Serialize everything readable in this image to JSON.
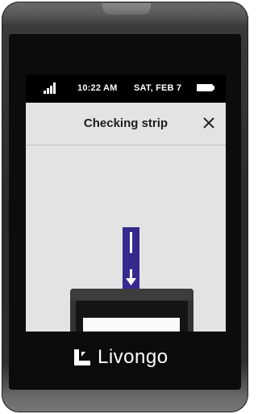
{
  "status_bar": {
    "time": "10:22 AM",
    "date": "SAT, FEB 7",
    "signal_icon": "signal-bars-icon",
    "battery_icon": "battery-full-icon"
  },
  "header": {
    "title": "Checking strip",
    "close_icon": "close-icon"
  },
  "illustration": {
    "strip_color": "#362a8e",
    "arrow_icon": "arrow-down-icon"
  },
  "brand": {
    "name": "Livongo",
    "logo_icon": "livongo-logo-icon"
  }
}
